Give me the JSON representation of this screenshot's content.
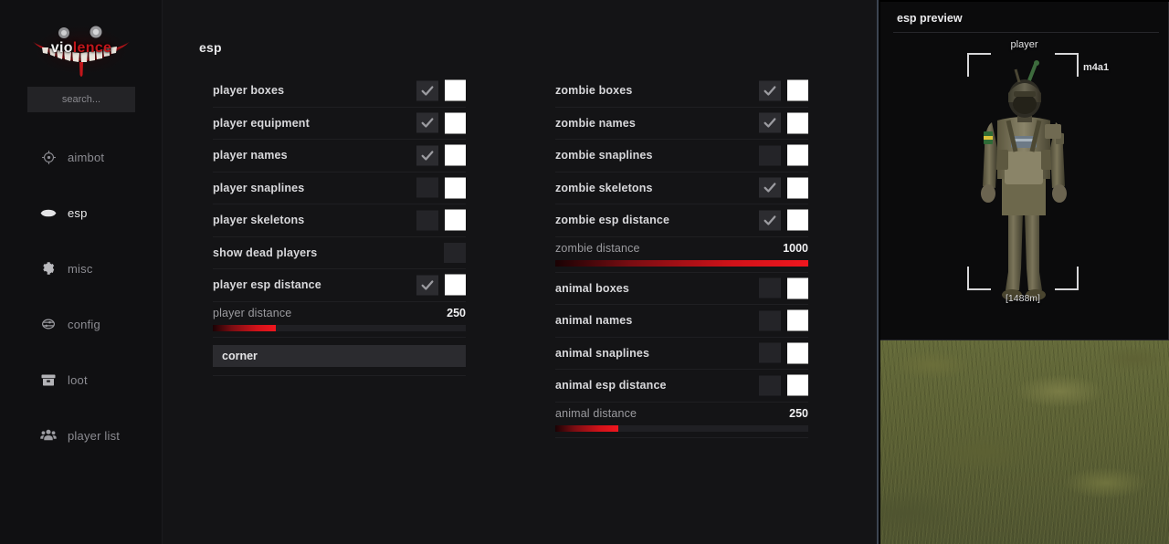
{
  "brand": {
    "name_part_white": "vio",
    "name_part_red": "lence",
    "accent_color": "#c2161b"
  },
  "search": {
    "placeholder": "search...",
    "value": ""
  },
  "sidebar": {
    "items": [
      {
        "label": "aimbot",
        "icon": "crosshair-icon",
        "active": false
      },
      {
        "label": "esp",
        "icon": "eye-icon",
        "active": true
      },
      {
        "label": "misc",
        "icon": "gear-icon",
        "active": false
      },
      {
        "label": "config",
        "icon": "sliders-icon",
        "active": false
      },
      {
        "label": "loot",
        "icon": "box-icon",
        "active": false
      },
      {
        "label": "player list",
        "icon": "people-icon",
        "active": false
      }
    ]
  },
  "main": {
    "title": "esp",
    "left_column": [
      {
        "type": "toggle",
        "label": "player boxes",
        "checked": true,
        "swatch": "#ffffff"
      },
      {
        "type": "toggle",
        "label": "player equipment",
        "checked": true,
        "swatch": "#ffffff"
      },
      {
        "type": "toggle",
        "label": "player names",
        "checked": true,
        "swatch": "#ffffff"
      },
      {
        "type": "toggle",
        "label": "player snaplines",
        "checked": false,
        "swatch": "#ffffff"
      },
      {
        "type": "toggle",
        "label": "player skeletons",
        "checked": false,
        "swatch": "#ffffff"
      },
      {
        "type": "toggle",
        "label": "show dead players",
        "checked": false,
        "swatch": null
      },
      {
        "type": "toggle",
        "label": "player esp distance",
        "checked": true,
        "swatch": "#ffffff"
      },
      {
        "type": "slider",
        "label": "player distance",
        "value": "250",
        "percent": 25
      },
      {
        "type": "dropdown",
        "label": "corner",
        "value": "corner"
      }
    ],
    "right_column": [
      {
        "type": "toggle",
        "label": "zombie boxes",
        "checked": true,
        "swatch": "#ffffff"
      },
      {
        "type": "toggle",
        "label": "zombie names",
        "checked": true,
        "swatch": "#ffffff"
      },
      {
        "type": "toggle",
        "label": "zombie snaplines",
        "checked": false,
        "swatch": "#ffffff"
      },
      {
        "type": "toggle",
        "label": "zombie skeletons",
        "checked": true,
        "swatch": "#ffffff"
      },
      {
        "type": "toggle",
        "label": "zombie esp distance",
        "checked": true,
        "swatch": "#ffffff"
      },
      {
        "type": "slider",
        "label": "zombie distance",
        "value": "1000",
        "percent": 100
      },
      {
        "type": "toggle",
        "label": "animal boxes",
        "checked": false,
        "swatch": "#ffffff"
      },
      {
        "type": "toggle",
        "label": "animal names",
        "checked": false,
        "swatch": "#ffffff"
      },
      {
        "type": "toggle",
        "label": "animal snaplines",
        "checked": false,
        "swatch": "#ffffff"
      },
      {
        "type": "toggle",
        "label": "animal esp distance",
        "checked": false,
        "swatch": "#ffffff"
      },
      {
        "type": "slider",
        "label": "animal distance",
        "value": "250",
        "percent": 25
      }
    ]
  },
  "preview": {
    "title": "esp preview",
    "entity_name": "player",
    "weapon": "m4a1",
    "distance": "[1488m]"
  }
}
